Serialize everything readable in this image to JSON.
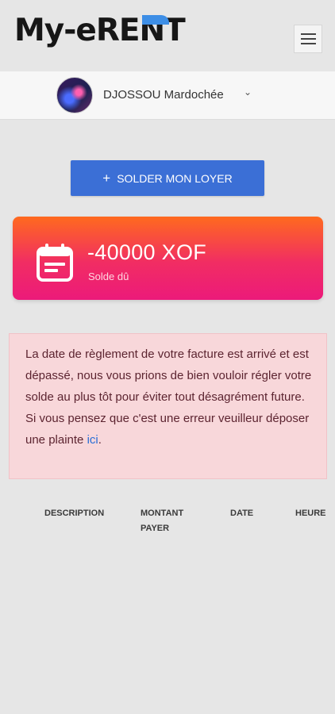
{
  "app": {
    "logo_text": "My-eRENT"
  },
  "header": {
    "menu_icon": "hamburger-menu-icon"
  },
  "user": {
    "name": "DJOSSOU Mardochée",
    "chevron": "⌄"
  },
  "actions": {
    "pay_button_icon": "+",
    "pay_button_label": "SOLDER MON LOYER"
  },
  "balance": {
    "amount": "-40000 XOF",
    "label": "Solde dû",
    "icon": "calendar-icon"
  },
  "alert": {
    "message": "La date de règlement de votre facture est arrivé et est dépassé, nous vous prions de bien vouloir régler votre solde au plus tôt pour éviter tout désagrément future. Si vous pensez que c'est une erreur veuilleur déposer une plainte ",
    "link_text": "ici",
    "suffix": "."
  },
  "table": {
    "columns": [
      {
        "label": "DESCRIPTION"
      },
      {
        "label": "MONTANT PAYER"
      },
      {
        "label": "DATE"
      },
      {
        "label": "HEURE"
      }
    ]
  },
  "colors": {
    "primary": "#3b6fd6",
    "gradient_start": "#ff6a1e",
    "gradient_end": "#ec1a7a",
    "alert_bg": "#f8d7da",
    "link": "#2a6fd6"
  }
}
